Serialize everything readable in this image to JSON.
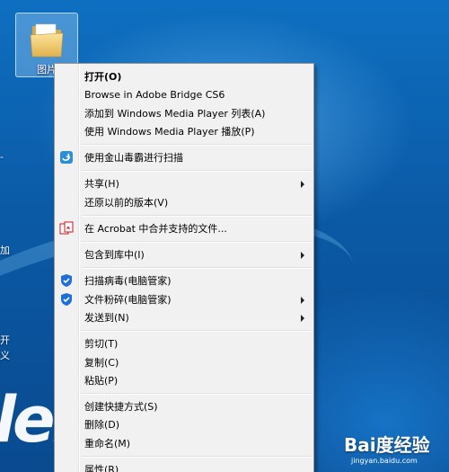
{
  "desktop": {
    "folder_label": "图片",
    "edge_fragments": [
      "",
      "-",
      "加",
      "开",
      "义"
    ]
  },
  "context_menu": {
    "items": [
      {
        "label": "打开(O)",
        "bold": true
      },
      {
        "label": "Browse in Adobe Bridge CS6"
      },
      {
        "label": "添加到 Windows Media Player 列表(A)"
      },
      {
        "label": "使用 Windows Media Player 播放(P)"
      },
      {
        "label": "使用金山毒霸进行扫描",
        "icon": "kingsoft-antivirus-icon"
      },
      {
        "label": "共享(H)",
        "submenu": true
      },
      {
        "label": "还原以前的版本(V)"
      },
      {
        "label": "在 Acrobat 中合并支持的文件...",
        "icon": "acrobat-icon"
      },
      {
        "label": "包含到库中(I)",
        "submenu": true
      },
      {
        "label": "扫描病毒(电脑管家)",
        "icon": "tencent-guard-icon"
      },
      {
        "label": "文件粉碎(电脑管家)",
        "icon": "tencent-guard-icon",
        "submenu": true
      },
      {
        "label": "发送到(N)",
        "submenu": true
      },
      {
        "label": "剪切(T)"
      },
      {
        "label": "复制(C)"
      },
      {
        "label": "粘贴(P)"
      },
      {
        "label": "创建快捷方式(S)"
      },
      {
        "label": "删除(D)"
      },
      {
        "label": "重命名(M)"
      },
      {
        "label": "属性(R)"
      }
    ]
  },
  "watermark": {
    "brand": "Bai度经验",
    "url": "jingyan.baidu.com"
  },
  "colors": {
    "menu_bg": "#f1f1f1",
    "desktop_blue": "#0b5fa8",
    "guard_blue": "#1e6fd9",
    "acrobat_red": "#d0121b"
  }
}
